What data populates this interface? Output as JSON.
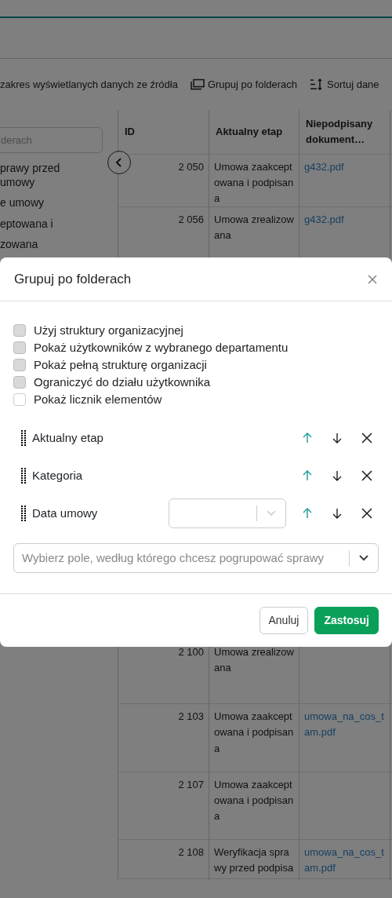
{
  "toolbar": {
    "source_range": "zakres wyświetlanych danych ze źródła",
    "group_button": "Grupuj po folderach",
    "sort_button": "Sortuj dane"
  },
  "sidebar": {
    "search": {
      "placeholder": "derach"
    },
    "items": [
      "prawy przed umowy",
      "e umowy",
      "eptowana i",
      "zowana"
    ]
  },
  "table": {
    "columns": [
      "ID",
      "Aktualny etap",
      "Niepodpisany dokument…"
    ],
    "rows_top": [
      {
        "id": "2 050",
        "stage": "Umowa zaakceptowana i podpisana",
        "document": "g432.pdf"
      },
      {
        "id": "2 056",
        "stage": "Umowa zrealizowana",
        "document": "g432.pdf"
      }
    ],
    "rows_bottom": [
      {
        "id": "2 100",
        "stage": "Umowa zrealizowana"
      },
      {
        "id": "2 103",
        "stage": "Umowa zaakceptowana i podpisana",
        "document": "umowa_na_cos_tam.pdf"
      },
      {
        "id": "2 107",
        "stage": "Umowa zaakceptowana i podpisana"
      },
      {
        "id": "2 108",
        "stage": "Weryfikacja sprawy przed podpisa",
        "document": "umowa_na_cos_tam.pdf"
      }
    ]
  },
  "modal": {
    "title": "Grupuj po folderach",
    "options": [
      {
        "label": "Użyj struktury organizacyjnej",
        "checked": false,
        "disabled": true
      },
      {
        "label": "Pokaż użytkowników z wybranego departamentu",
        "checked": false,
        "disabled": true
      },
      {
        "label": "Pokaż pełną strukturę organizacji",
        "checked": false,
        "disabled": true
      },
      {
        "label": "Ograniczyć do działu użytkownika",
        "checked": false,
        "disabled": true
      },
      {
        "label": "Pokaż licznik elementów",
        "checked": false,
        "disabled": false
      }
    ],
    "groups": [
      {
        "label": "Aktualny etap",
        "kind": "plain"
      },
      {
        "label": "Kategoria",
        "kind": "plain"
      },
      {
        "label": "Data umowy",
        "kind": "select"
      }
    ],
    "field_select": {
      "placeholder": "Wybierz pole, według którego chcesz pogrupować sprawy"
    },
    "buttons": {
      "cancel": "Anuluj",
      "apply": "Zastosuj"
    }
  }
}
